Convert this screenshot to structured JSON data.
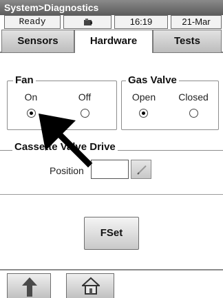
{
  "window": {
    "title": "System>Diagnostics"
  },
  "status": {
    "state": "Ready",
    "icon": "device-icon",
    "time": "16:19",
    "date": "21-Mar"
  },
  "tabs": [
    {
      "label": "Sensors",
      "active": false
    },
    {
      "label": "Hardware",
      "active": true
    },
    {
      "label": "Tests",
      "active": false
    }
  ],
  "fan": {
    "legend": "Fan",
    "on_label": "On",
    "off_label": "Off",
    "selected": "On"
  },
  "gas_valve": {
    "legend": "Gas Valve",
    "open_label": "Open",
    "closed_label": "Closed",
    "selected": "Open"
  },
  "cassette": {
    "legend": "Cassette Valve Drive",
    "position_label": "Position",
    "position_value": ""
  },
  "actions": {
    "fset_label": "FSet"
  },
  "nav": {
    "up_icon": "up-arrow-icon",
    "home_icon": "home-icon"
  },
  "colors": {
    "title_bar": "#6e6e6e",
    "arrow": "#000000"
  }
}
